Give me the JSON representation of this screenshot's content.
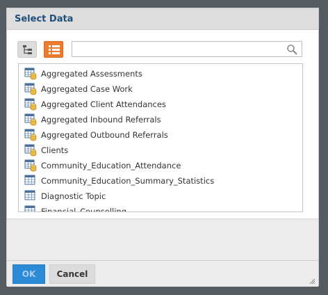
{
  "dialog": {
    "title": "Select Data",
    "search": {
      "value": "",
      "placeholder": ""
    },
    "toolbar": {
      "tree_icon": "tree-view-icon",
      "list_icon": "list-view-icon",
      "active": "list"
    },
    "items": [
      {
        "label": "Aggregated Assessments",
        "icon": "table-db-icon"
      },
      {
        "label": "Aggregated Case Work",
        "icon": "table-db-icon"
      },
      {
        "label": "Aggregated Client Attendances",
        "icon": "table-db-icon"
      },
      {
        "label": "Aggregated Inbound Referrals",
        "icon": "table-db-icon"
      },
      {
        "label": "Aggregated Outbound Referrals",
        "icon": "table-db-icon"
      },
      {
        "label": "Clients",
        "icon": "table-db-icon"
      },
      {
        "label": "Community_Education_Attendance",
        "icon": "table-db-icon"
      },
      {
        "label": "Community_Education_Summary_Statistics",
        "icon": "table-icon"
      },
      {
        "label": "Diagnostic Topic",
        "icon": "table-icon"
      },
      {
        "label": "Financial_Counselling",
        "icon": "table-icon"
      }
    ],
    "buttons": {
      "ok": "OK",
      "cancel": "Cancel"
    },
    "colors": {
      "title": "#1f4e79",
      "accent": "#ef7b2f",
      "primary": "#2b8bd6"
    }
  }
}
